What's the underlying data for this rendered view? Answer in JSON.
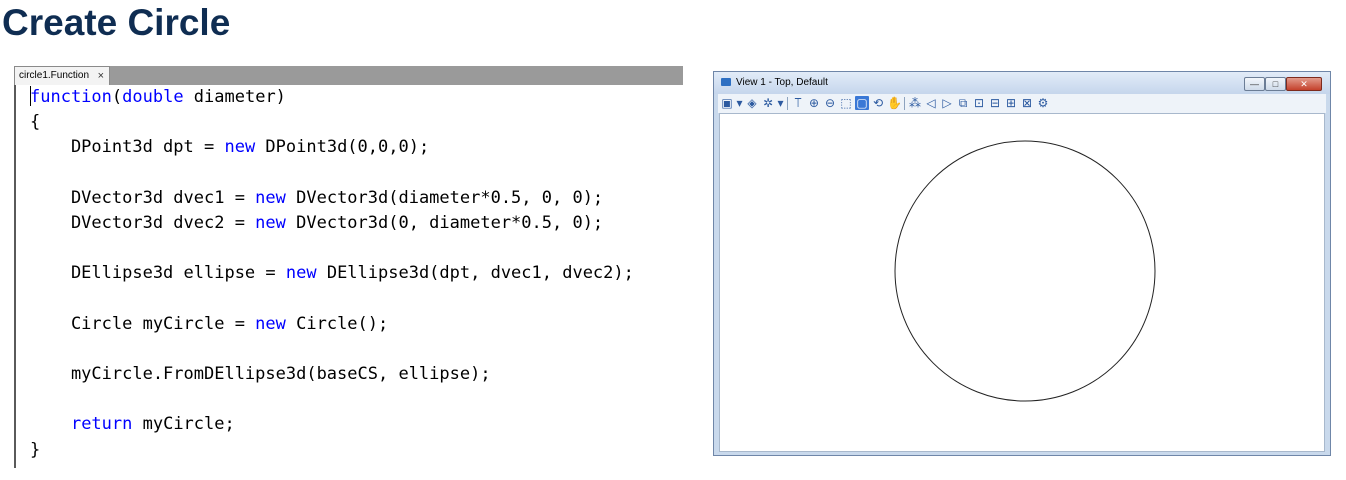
{
  "page": {
    "title": "Create Circle"
  },
  "editor": {
    "tab_label": "circle1.Function",
    "tab_close": "×",
    "lines": [
      [
        {
          "t": "function",
          "k": true
        },
        {
          "t": "("
        },
        {
          "t": "double",
          "k": true
        },
        {
          "t": " diameter)"
        }
      ],
      [
        {
          "t": "{"
        }
      ],
      [
        {
          "t": "    DPoint3d dpt = "
        },
        {
          "t": "new",
          "k": true
        },
        {
          "t": " DPoint3d(0,0,0);"
        }
      ],
      [],
      [
        {
          "t": "    DVector3d dvec1 = "
        },
        {
          "t": "new",
          "k": true
        },
        {
          "t": " DVector3d(diameter*0.5, 0, 0);"
        }
      ],
      [
        {
          "t": "    DVector3d dvec2 = "
        },
        {
          "t": "new",
          "k": true
        },
        {
          "t": " DVector3d(0, diameter*0.5, 0);"
        }
      ],
      [],
      [
        {
          "t": "    DEllipse3d ellipse = "
        },
        {
          "t": "new",
          "k": true
        },
        {
          "t": " DEllipse3d(dpt, dvec1, dvec2);"
        }
      ],
      [],
      [
        {
          "t": "    Circle myCircle = "
        },
        {
          "t": "new",
          "k": true
        },
        {
          "t": " Circle();"
        }
      ],
      [],
      [
        {
          "t": "    myCircle.FromDEllipse3d(baseCS, ellipse);"
        }
      ],
      [],
      [
        {
          "t": "    "
        },
        {
          "t": "return",
          "k": true
        },
        {
          "t": " myCircle;"
        }
      ],
      [
        {
          "t": "}"
        }
      ]
    ],
    "keyword_color": "#0000ff"
  },
  "view": {
    "title": "View 1 - Top, Default",
    "buttons": {
      "minimize": "—",
      "maximize": "□",
      "close": "✕"
    },
    "toolbar_icons": [
      "view-attributes-icon",
      "dropdown-arrow-icon",
      "level-display-icon",
      "display-style-icon",
      "dropdown-arrow-icon",
      "update-view-icon",
      "zoom-in-icon",
      "zoom-out-icon",
      "window-area-icon",
      "fit-view-icon",
      "rotate-view-icon",
      "pan-view-icon",
      "walk-icon",
      "view-previous-icon",
      "view-next-icon",
      "copy-view-icon",
      "camera-icon",
      "clip-volume-icon",
      "clip-mask-icon",
      "reset-icon",
      "view-settings-icon"
    ],
    "active_icon": "fit-view-icon"
  }
}
